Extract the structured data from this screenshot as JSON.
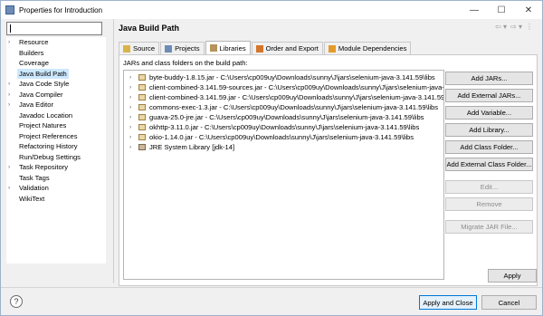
{
  "window": {
    "title": "Properties for Introduction",
    "controls": {
      "minimize": "—",
      "maximize": "☐",
      "close": "✕"
    }
  },
  "filter": {
    "value": ""
  },
  "nav": {
    "items": [
      {
        "label": "Resource",
        "expandable": true
      },
      {
        "label": "Builders",
        "expandable": false
      },
      {
        "label": "Coverage",
        "expandable": false
      },
      {
        "label": "Java Build Path",
        "expandable": false,
        "selected": true
      },
      {
        "label": "Java Code Style",
        "expandable": true
      },
      {
        "label": "Java Compiler",
        "expandable": true
      },
      {
        "label": "Java Editor",
        "expandable": true
      },
      {
        "label": "Javadoc Location",
        "expandable": false
      },
      {
        "label": "Project Natures",
        "expandable": false
      },
      {
        "label": "Project References",
        "expandable": false
      },
      {
        "label": "Refactoring History",
        "expandable": false
      },
      {
        "label": "Run/Debug Settings",
        "expandable": false
      },
      {
        "label": "Task Repository",
        "expandable": true
      },
      {
        "label": "Task Tags",
        "expandable": false
      },
      {
        "label": "Validation",
        "expandable": true
      },
      {
        "label": "WikiText",
        "expandable": false
      }
    ]
  },
  "page": {
    "title": "Java Build Path",
    "nav_arrows": {
      "back": "⇦ ▾",
      "forward": "⇨ ▾",
      "menu": "⋮"
    }
  },
  "tabs": [
    {
      "label": "Source",
      "icon": "source-folder-icon",
      "color": "#d9b44a"
    },
    {
      "label": "Projects",
      "icon": "projects-icon",
      "color": "#6d8cb5"
    },
    {
      "label": "Libraries",
      "icon": "libraries-icon",
      "color": "#b5935a",
      "active": true
    },
    {
      "label": "Order and Export",
      "icon": "order-export-icon",
      "color": "#d4762c"
    },
    {
      "label": "Module Dependencies",
      "icon": "module-dependencies-icon",
      "color": "#e59a2b"
    }
  ],
  "libraries": {
    "caption": "JARs and class folders on the build path:",
    "entries": [
      {
        "text": "byte-buddy-1.8.15.jar - C:\\Users\\cp009uy\\Downloads\\sunny\\J\\jars\\selenium-java-3.141.59\\libs",
        "type": "jar"
      },
      {
        "text": "client-combined-3.141.59-sources.jar - C:\\Users\\cp009uy\\Downloads\\sunny\\J\\jars\\selenium-java-3.141.59",
        "type": "jar"
      },
      {
        "text": "client-combined-3.141.59.jar - C:\\Users\\cp009uy\\Downloads\\sunny\\J\\jars\\selenium-java-3.141.59",
        "type": "jar"
      },
      {
        "text": "commons-exec-1.3.jar - C:\\Users\\cp009uy\\Downloads\\sunny\\J\\jars\\selenium-java-3.141.59\\libs",
        "type": "jar"
      },
      {
        "text": "guava-25.0-jre.jar - C:\\Users\\cp009uy\\Downloads\\sunny\\J\\jars\\selenium-java-3.141.59\\libs",
        "type": "jar"
      },
      {
        "text": "okhttp-3.11.0.jar - C:\\Users\\cp009uy\\Downloads\\sunny\\J\\jars\\selenium-java-3.141.59\\libs",
        "type": "jar"
      },
      {
        "text": "okio-1.14.0.jar - C:\\Users\\cp009uy\\Downloads\\sunny\\J\\jars\\selenium-java-3.141.59\\libs",
        "type": "jar"
      },
      {
        "text": "JRE System Library [jdk-14]",
        "type": "library"
      }
    ]
  },
  "buttons": {
    "add_jars": "Add JARs...",
    "add_external_jars": "Add External JARs...",
    "add_variable": "Add Variable...",
    "add_library": "Add Library...",
    "add_class_folder": "Add Class Folder...",
    "add_external_class_folder": "Add External Class Folder...",
    "edit": "Edit...",
    "remove": "Remove",
    "migrate_jar": "Migrate JAR File...",
    "apply": "Apply",
    "apply_and_close": "Apply and Close",
    "cancel": "Cancel",
    "help": "?"
  }
}
